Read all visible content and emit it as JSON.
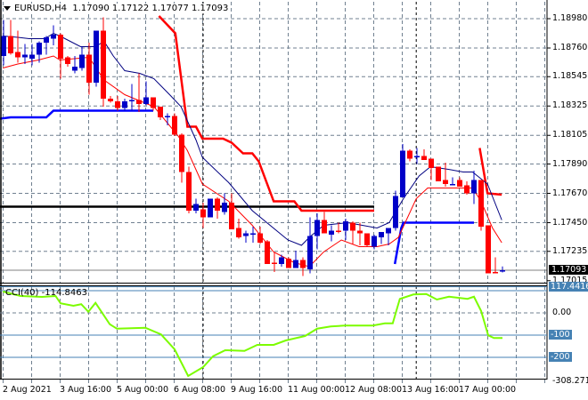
{
  "header": {
    "symbol": "EURUSD,H4",
    "open": "1.17090",
    "high": "1.17122",
    "low": "1.17077",
    "close": "1.17093"
  },
  "indicator": {
    "label": "CCI(40) -114.8463"
  },
  "colors": {
    "bull": "#0000c8",
    "bear": "#ff0000",
    "ma_upper": "#000080",
    "ma_lower": "#ff0000",
    "stop_red": "#ff0000",
    "stop_blue": "#0000ff",
    "cci": "#7cfc00",
    "level": "#4682b4",
    "grid": "#708090"
  },
  "chart_data": {
    "type": "candlestick",
    "title": "EURUSD,H4",
    "price_axis": {
      "ticks": [
        "1.18980",
        "1.18760",
        "1.18545",
        "1.18325",
        "1.18105",
        "1.17890",
        "1.17670",
        "1.17450",
        "1.17235",
        "1.17015"
      ],
      "current": "1.17093"
    },
    "time_axis": [
      "2 Aug 2021",
      "3 Aug 16:00",
      "5 Aug 00:00",
      "6 Aug 08:00",
      "9 Aug 16:00",
      "11 Aug 00:00",
      "12 Aug 08:00",
      "13 Aug 16:00",
      "17 Aug 00:00"
    ],
    "candles_ohlc": [
      [
        1.187,
        1.1897,
        1.1863,
        1.1885
      ],
      [
        1.1885,
        1.1897,
        1.1871,
        1.1872
      ],
      [
        1.1873,
        1.1889,
        1.1865,
        1.1869
      ],
      [
        1.1869,
        1.1879,
        1.1864,
        1.1871
      ],
      [
        1.1868,
        1.1879,
        1.1863,
        1.1871
      ],
      [
        1.1871,
        1.1881,
        1.1865,
        1.188
      ],
      [
        1.188,
        1.1885,
        1.1871,
        1.1884
      ],
      [
        1.1883,
        1.1893,
        1.1878,
        1.1886
      ],
      [
        1.1886,
        1.1887,
        1.1853,
        1.1868
      ],
      [
        1.1869,
        1.187,
        1.1862,
        1.1864
      ],
      [
        1.1859,
        1.187,
        1.1857,
        1.1862
      ],
      [
        1.1861,
        1.1877,
        1.1859,
        1.1871
      ],
      [
        1.1871,
        1.188,
        1.1841,
        1.185
      ],
      [
        1.185,
        1.1889,
        1.1847,
        1.1889
      ],
      [
        1.1889,
        1.1899,
        1.1832,
        1.1838
      ],
      [
        1.1838,
        1.184,
        1.1835,
        1.1836
      ],
      [
        1.1836,
        1.184,
        1.1829,
        1.1831
      ],
      [
        1.1831,
        1.1838,
        1.1829,
        1.1836
      ],
      [
        1.1836,
        1.1849,
        1.1829,
        1.1837
      ],
      [
        1.1837,
        1.1857,
        1.1828,
        1.1834
      ],
      [
        1.1834,
        1.1851,
        1.1833,
        1.1839
      ],
      [
        1.1839,
        1.1839,
        1.1829,
        1.1831
      ],
      [
        1.1832,
        1.1832,
        1.1822,
        1.1824
      ],
      [
        1.1825,
        1.1827,
        1.1818,
        1.1825
      ],
      [
        1.1825,
        1.1827,
        1.181,
        1.1811
      ],
      [
        1.1811,
        1.1812,
        1.1775,
        1.1783
      ],
      [
        1.1783,
        1.1787,
        1.1752,
        1.1754
      ],
      [
        1.1754,
        1.1763,
        1.1752,
        1.1759
      ],
      [
        1.1755,
        1.176,
        1.1741,
        1.1749
      ],
      [
        1.1749,
        1.1763,
        1.1749,
        1.1763
      ],
      [
        1.1763,
        1.1764,
        1.1748,
        1.1754
      ],
      [
        1.1753,
        1.1767,
        1.1751,
        1.176
      ],
      [
        1.176,
        1.1767,
        1.174,
        1.174
      ],
      [
        1.1741,
        1.1748,
        1.1733,
        1.1734
      ],
      [
        1.1735,
        1.1739,
        1.173,
        1.1737
      ],
      [
        1.1736,
        1.1742,
        1.173,
        1.1737
      ],
      [
        1.1737,
        1.1742,
        1.1729,
        1.173
      ],
      [
        1.1731,
        1.1732,
        1.1714,
        1.1714
      ],
      [
        1.1715,
        1.1723,
        1.1708,
        1.1714
      ],
      [
        1.1714,
        1.1721,
        1.1712,
        1.1719
      ],
      [
        1.1718,
        1.1719,
        1.1711,
        1.1711
      ],
      [
        1.1711,
        1.1724,
        1.1711,
        1.1717
      ],
      [
        1.1717,
        1.1719,
        1.1705,
        1.1711
      ],
      [
        1.171,
        1.1749,
        1.1707,
        1.1735
      ],
      [
        1.1735,
        1.1752,
        1.1725,
        1.1747
      ],
      [
        1.1747,
        1.1753,
        1.1737,
        1.1737
      ],
      [
        1.1736,
        1.1743,
        1.1731,
        1.1739
      ],
      [
        1.1739,
        1.1745,
        1.1737,
        1.1738
      ],
      [
        1.1739,
        1.1748,
        1.1732,
        1.1746
      ],
      [
        1.1745,
        1.1746,
        1.1729,
        1.1739
      ],
      [
        1.1739,
        1.1745,
        1.1728,
        1.1737
      ],
      [
        1.1737,
        1.1737,
        1.1727,
        1.1728
      ],
      [
        1.1727,
        1.1736,
        1.1725,
        1.1735
      ],
      [
        1.1734,
        1.1738,
        1.1729,
        1.1738
      ],
      [
        1.1737,
        1.1741,
        1.1728,
        1.1741
      ],
      [
        1.1741,
        1.1769,
        1.1739,
        1.1765
      ],
      [
        1.1764,
        1.1804,
        1.1764,
        1.1799
      ],
      [
        1.1799,
        1.18,
        1.1791,
        1.1793
      ],
      [
        1.1794,
        1.1801,
        1.1789,
        1.1795
      ],
      [
        1.1795,
        1.18,
        1.1792,
        1.1792
      ],
      [
        1.1793,
        1.1793,
        1.1777,
        1.1786
      ],
      [
        1.1787,
        1.1787,
        1.1776,
        1.1776
      ],
      [
        1.1777,
        1.179,
        1.1772,
        1.1774
      ],
      [
        1.1773,
        1.1779,
        1.1773,
        1.1774
      ],
      [
        1.1777,
        1.1779,
        1.1772,
        1.1772
      ],
      [
        1.1773,
        1.1776,
        1.1766,
        1.1767
      ],
      [
        1.1767,
        1.1784,
        1.1759,
        1.1777
      ],
      [
        1.1777,
        1.1777,
        1.1739,
        1.1742
      ],
      [
        1.1743,
        1.1743,
        1.1707,
        1.1707
      ],
      [
        1.1708,
        1.1719,
        1.1707,
        1.1707
      ],
      [
        1.1709,
        1.17122,
        1.17077,
        1.17093
      ]
    ],
    "lines": {
      "ma_upper": [
        [
          -0.1,
          1.1885
        ],
        [
          2,
          1.1884
        ],
        [
          3.6,
          1.1883
        ],
        [
          5.8,
          1.1883
        ],
        [
          7,
          1.1887
        ],
        [
          7.9,
          1.1885
        ],
        [
          10.8,
          1.1877
        ],
        [
          12.9,
          1.1877
        ],
        [
          14.1,
          1.1881
        ],
        [
          15.4,
          1.187
        ],
        [
          17,
          1.1859
        ],
        [
          19.1,
          1.1857
        ],
        [
          21.1,
          1.1853
        ],
        [
          23.3,
          1.1841
        ],
        [
          24.9,
          1.1832
        ],
        [
          27,
          1.1807
        ],
        [
          27.9,
          1.1794
        ],
        [
          31.6,
          1.1775
        ],
        [
          34.9,
          1.1754
        ],
        [
          39.9,
          1.1732
        ],
        [
          41.8,
          1.1728
        ],
        [
          42.9,
          1.1734
        ],
        [
          44.9,
          1.1743
        ],
        [
          48.3,
          1.1745
        ],
        [
          52.4,
          1.1741
        ],
        [
          54.1,
          1.1745
        ],
        [
          56.1,
          1.1763
        ],
        [
          58.3,
          1.178
        ],
        [
          59.9,
          1.1787
        ],
        [
          62.4,
          1.1785
        ],
        [
          64.5,
          1.1783
        ],
        [
          65.8,
          1.1783
        ],
        [
          67.9,
          1.1774
        ],
        [
          69.9,
          1.1747
        ]
      ],
      "ma_lower": [
        [
          -0.1,
          1.1861
        ],
        [
          2,
          1.1864
        ],
        [
          4.9,
          1.1867
        ],
        [
          7,
          1.187
        ],
        [
          7.9,
          1.1867
        ],
        [
          12,
          1.1869
        ],
        [
          14.1,
          1.1852
        ],
        [
          17,
          1.1841
        ],
        [
          21.1,
          1.1832
        ],
        [
          24.5,
          1.181
        ],
        [
          25.8,
          1.1799
        ],
        [
          27.9,
          1.1774
        ],
        [
          31.6,
          1.1761
        ],
        [
          34.9,
          1.1743
        ],
        [
          37.9,
          1.1723
        ],
        [
          40.8,
          1.1715
        ],
        [
          42.9,
          1.1712
        ],
        [
          44.9,
          1.1723
        ],
        [
          47.4,
          1.1732
        ],
        [
          49.9,
          1.1727
        ],
        [
          52.4,
          1.1727
        ],
        [
          54.1,
          1.1729
        ],
        [
          55.4,
          1.1734
        ],
        [
          57.9,
          1.1763
        ],
        [
          59.5,
          1.1771
        ],
        [
          65.8,
          1.1771
        ],
        [
          67,
          1.1761
        ],
        [
          68.6,
          1.1741
        ],
        [
          69.9,
          1.173
        ]
      ],
      "stop_red": [
        [
          [
            21.8,
            1.19
          ],
          [
            24.1,
            1.1887
          ],
          [
            25.8,
            1.1817
          ],
          [
            27,
            1.1817
          ],
          [
            27.9,
            1.1808
          ],
          [
            30.8,
            1.1808
          ],
          [
            32,
            1.1805
          ],
          [
            33.6,
            1.1797
          ],
          [
            34.9,
            1.1797
          ],
          [
            35.8,
            1.1791
          ],
          [
            37.9,
            1.1761
          ],
          [
            40.8,
            1.1761
          ],
          [
            41.8,
            1.1754
          ],
          [
            52,
            1.1754
          ]
        ],
        [
          [
            66.8,
            1.1801
          ],
          [
            67.9,
            1.1767
          ],
          [
            69.9,
            1.1766
          ]
        ]
      ],
      "stop_blue": [
        [
          [
            -0.5,
            1.1823
          ],
          [
            1,
            1.1824
          ],
          [
            6,
            1.1824
          ],
          [
            7,
            1.1829
          ],
          [
            21,
            1.1829
          ]
        ],
        [
          [
            54.9,
            1.1714
          ],
          [
            55.8,
            1.1741
          ],
          [
            56.1,
            1.1745
          ],
          [
            66,
            1.1745
          ]
        ]
      ],
      "level_black": [
        [
          -0.5,
          1.1757
        ],
        [
          52,
          1.1757
        ]
      ]
    },
    "separators_bar": [
      28,
      57.9
    ],
    "cci": {
      "period": 40,
      "last": -114.8463,
      "axis_labels": [
        "117.4416",
        "0.00",
        "-100",
        "-200",
        "-308.2717"
      ],
      "range": [
        -308.2717,
        117.4416
      ],
      "levels": [
        100,
        -100,
        -200
      ],
      "points": [
        [
          -0.1,
          96
        ],
        [
          2.4,
          76
        ],
        [
          5.4,
          72
        ],
        [
          7.3,
          76
        ],
        [
          8,
          43
        ],
        [
          9.8,
          32
        ],
        [
          10.9,
          39
        ],
        [
          11.9,
          5
        ],
        [
          12.9,
          45
        ],
        [
          14.9,
          -51
        ],
        [
          15.9,
          -71
        ],
        [
          19.9,
          -67
        ],
        [
          22.1,
          -97
        ],
        [
          24,
          -164
        ],
        [
          25.9,
          -284
        ],
        [
          28,
          -244
        ],
        [
          29.4,
          -195
        ],
        [
          31.1,
          -168
        ],
        [
          33.8,
          -171
        ],
        [
          35.6,
          -144
        ],
        [
          37.9,
          -144
        ],
        [
          39.6,
          -124
        ],
        [
          42.3,
          -104
        ],
        [
          44,
          -71
        ],
        [
          45.9,
          -61
        ],
        [
          47.9,
          -57
        ],
        [
          51.8,
          -57
        ],
        [
          53.5,
          -47
        ],
        [
          54.6,
          -47
        ],
        [
          55.6,
          63
        ],
        [
          57.5,
          83
        ],
        [
          59.3,
          85
        ],
        [
          60.8,
          60
        ],
        [
          62.5,
          73
        ],
        [
          65.1,
          63
        ],
        [
          66,
          73
        ],
        [
          67,
          9
        ],
        [
          68,
          -101
        ],
        [
          68.8,
          -113
        ],
        [
          70,
          -113
        ]
      ]
    }
  }
}
